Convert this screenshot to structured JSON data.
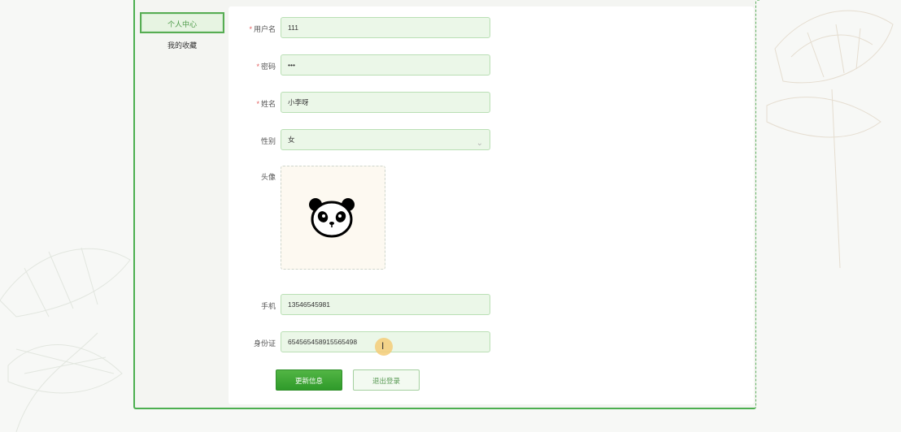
{
  "sidebar": {
    "items": [
      {
        "label": "个人中心",
        "active": true
      },
      {
        "label": "我的收藏",
        "active": false
      }
    ]
  },
  "form": {
    "username": {
      "label": "用户名",
      "required": true,
      "value": "111"
    },
    "password": {
      "label": "密码",
      "required": true,
      "value": "•••"
    },
    "name": {
      "label": "姓名",
      "required": true,
      "value": "小李呀"
    },
    "gender": {
      "label": "性别",
      "required": false,
      "value": "女"
    },
    "avatar": {
      "label": "头像"
    },
    "phone": {
      "label": "手机",
      "required": false,
      "value": "13546545981"
    },
    "id_card": {
      "label": "身份证",
      "required": false,
      "value": "654565458915565498"
    }
  },
  "actions": {
    "update_label": "更新信息",
    "logout_label": "退出登录"
  },
  "colors": {
    "accent": "#4caf50",
    "input_bg": "#ebf7e8",
    "required": "#e25c5c"
  },
  "icons": {
    "avatar": "panda-icon",
    "select": "chevron-down-icon",
    "cursor": "text-cursor-icon"
  }
}
